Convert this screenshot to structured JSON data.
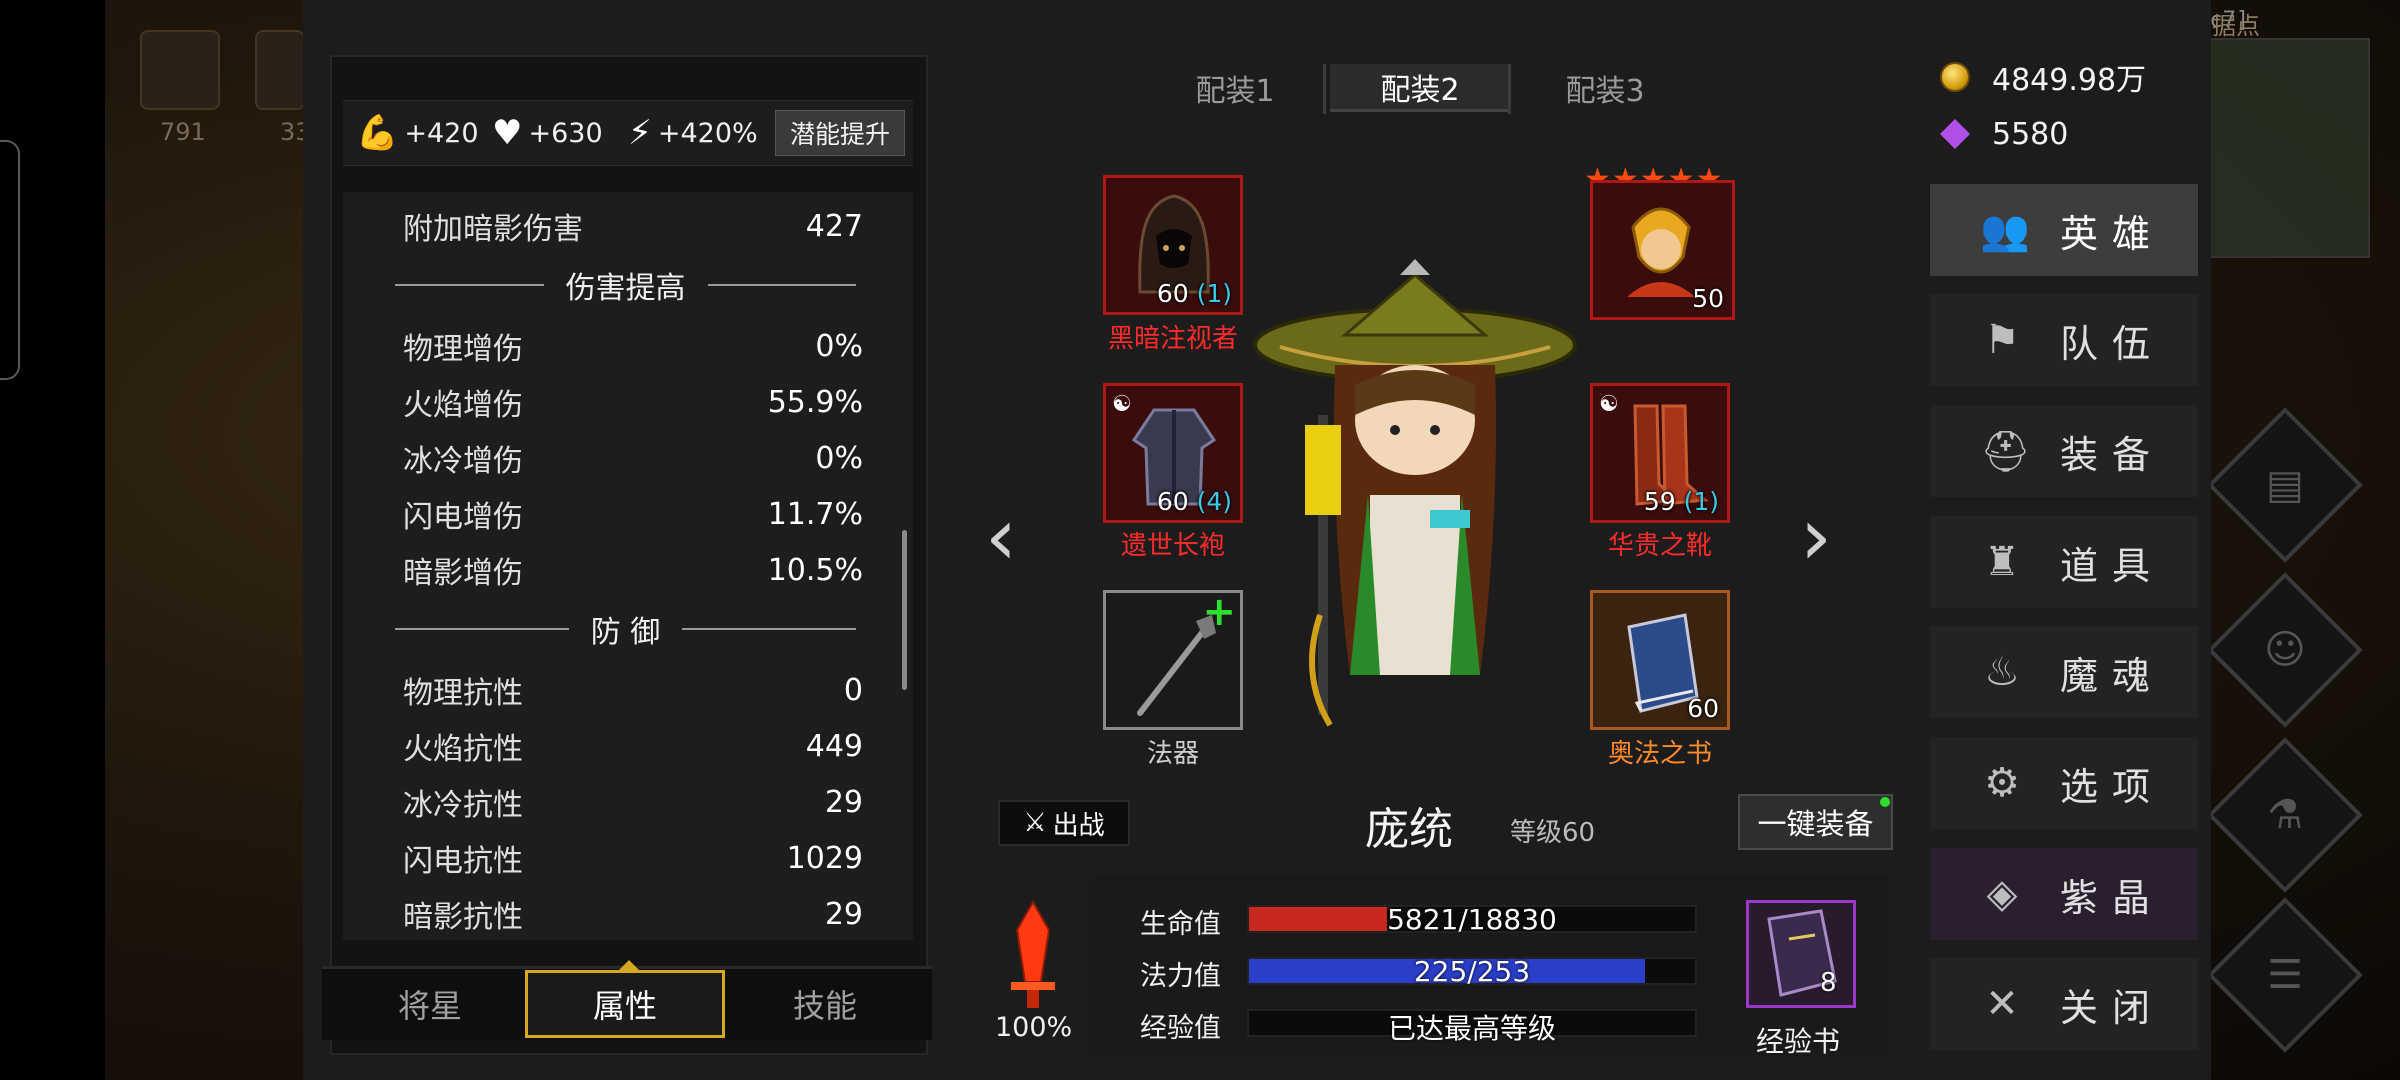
{
  "session_id": "[5e540291-0e30-4aca-acc7]",
  "world": {
    "stronghold_label": "据点",
    "icon_counts": [
      "791",
      "33"
    ]
  },
  "potential": {
    "str": "+420",
    "hp": "+630",
    "spd": "+420%",
    "button": "潜能提升"
  },
  "stats": {
    "top_row": {
      "label": "附加暗影伤害",
      "value": "427"
    },
    "damage_header": "伤害提高",
    "damage": [
      {
        "label": "物理增伤",
        "value": "0%"
      },
      {
        "label": "火焰增伤",
        "value": "55.9%"
      },
      {
        "label": "冰冷增伤",
        "value": "0%"
      },
      {
        "label": "闪电增伤",
        "value": "11.7%"
      },
      {
        "label": "暗影增伤",
        "value": "10.5%"
      }
    ],
    "defense_header": "防 御",
    "defense": [
      {
        "label": "物理抗性",
        "value": "0"
      },
      {
        "label": "火焰抗性",
        "value": "449"
      },
      {
        "label": "冰冷抗性",
        "value": "29"
      },
      {
        "label": "闪电抗性",
        "value": "1029"
      },
      {
        "label": "暗影抗性",
        "value": "29"
      }
    ]
  },
  "bottom_tabs": [
    "将星",
    "属性",
    "技能"
  ],
  "loadout_tabs": [
    "配装1",
    "配装2",
    "配装3"
  ],
  "equipment": {
    "helmet": {
      "name": "黑暗注视者",
      "level": "60",
      "enhance": "(1)"
    },
    "robe": {
      "name": "遗世长袍",
      "level": "60",
      "enhance": "(4)"
    },
    "weapon": {
      "name": "法器"
    },
    "mount": {
      "level": "50",
      "stars": "★★★★★"
    },
    "boots": {
      "name": "华贵之靴",
      "level": "59",
      "enhance": "(1)"
    },
    "book": {
      "name": "奥法之书",
      "level": "60"
    }
  },
  "hero": {
    "name": "庞统",
    "level_label": "等级60",
    "deploy_label": "出战",
    "auto_equip_label": "一键装备"
  },
  "vitals": {
    "hp_label": "生命值",
    "hp_text": "5821/18830",
    "hp_ratio": 0.309,
    "mp_label": "法力值",
    "mp_text": "225/253",
    "mp_ratio": 0.889,
    "exp_label": "经验值",
    "exp_text": "已达最高等级",
    "power_pct": "100%"
  },
  "exp_book": {
    "label": "经验书",
    "count": "8"
  },
  "currency": {
    "gold": "4849.98万",
    "gems": "5580"
  },
  "menu": [
    "英雄",
    "队伍",
    "装备",
    "道具",
    "魔魂",
    "选项",
    "紫晶",
    "关闭"
  ],
  "colors": {
    "hp": "#c8281e",
    "mp": "#2a3ec8",
    "accent": "#d6a820",
    "rare_red": "#ff2a2a",
    "legend_orange": "#ff8a2a"
  }
}
